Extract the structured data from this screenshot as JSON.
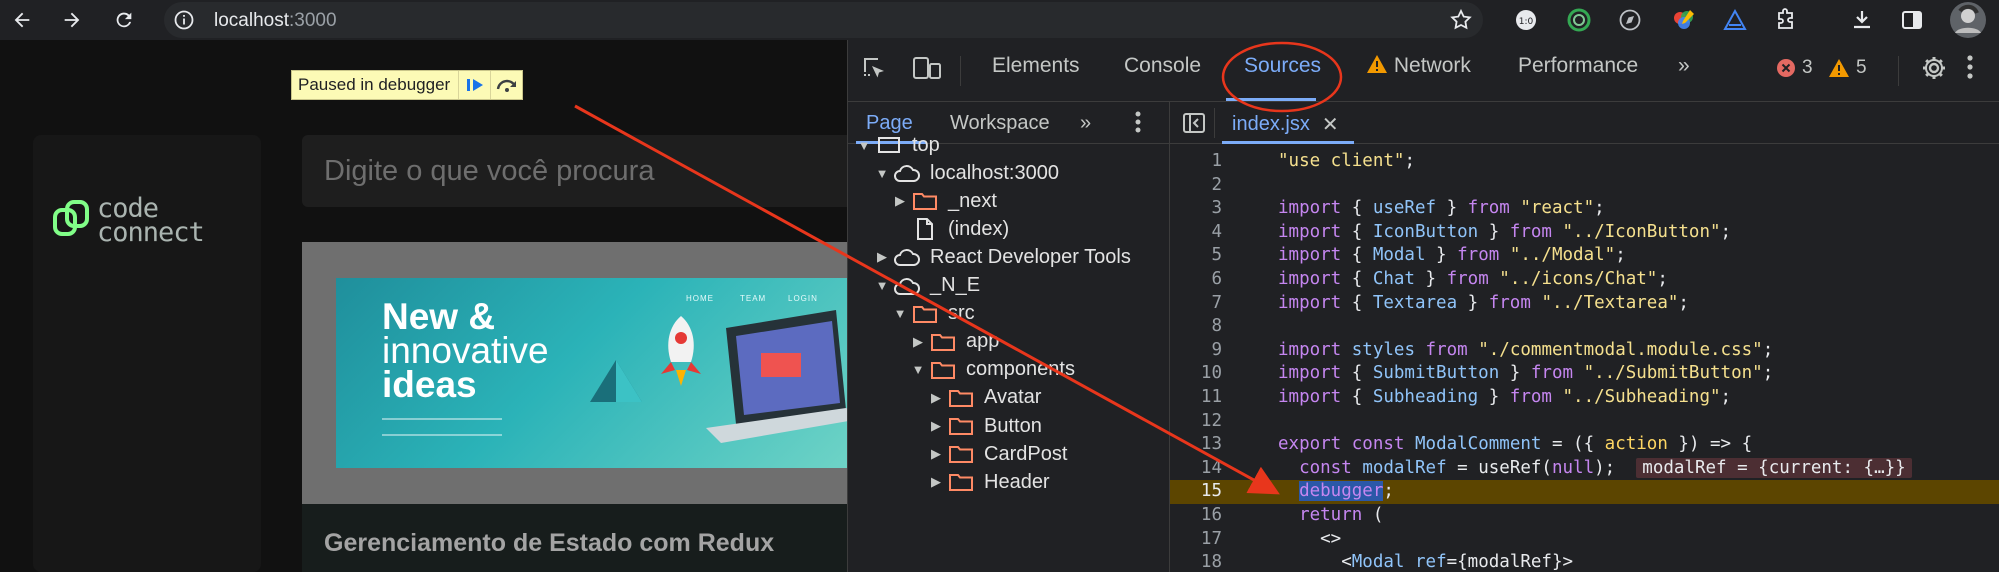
{
  "browser": {
    "url_host": "localhost",
    "url_port": ":3000",
    "extensions": [
      "extension-1-icon",
      "extension-2-icon",
      "extension-3-icon",
      "extension-4-icon",
      "extension-5-icon"
    ]
  },
  "page": {
    "paused_banner": "Paused in debugger",
    "logo_line1": "code",
    "logo_line2": "connect",
    "search_placeholder": "Digite o que você procura",
    "banner": {
      "line1": "New &",
      "line2": "innovative",
      "line3": "ideas",
      "nav": [
        "HOME",
        "TEAM",
        "LOGIN"
      ]
    },
    "card_title": "Gerenciamento de Estado com Redux"
  },
  "devtools": {
    "tabs": [
      "Elements",
      "Console",
      "Sources",
      "Network",
      "Performance"
    ],
    "active_tab": "Sources",
    "error_count": "3",
    "warning_count": "5",
    "nav_tabs": [
      "Page",
      "Workspace"
    ],
    "active_nav_tab": "Page",
    "tree": [
      {
        "label": "top",
        "depth": 0,
        "type": "frame",
        "expanded": true
      },
      {
        "label": "localhost:3000",
        "depth": 1,
        "type": "cloud",
        "expanded": true
      },
      {
        "label": "_next",
        "depth": 2,
        "type": "folder",
        "expanded": false
      },
      {
        "label": "(index)",
        "depth": 2,
        "type": "file",
        "expanded": null
      },
      {
        "label": "React Developer Tools",
        "depth": 1,
        "type": "cloud",
        "expanded": false
      },
      {
        "label": "_N_E",
        "depth": 1,
        "type": "cloud",
        "expanded": true
      },
      {
        "label": "src",
        "depth": 2,
        "type": "folder",
        "expanded": true
      },
      {
        "label": "app",
        "depth": 3,
        "type": "folder",
        "expanded": false
      },
      {
        "label": "components",
        "depth": 3,
        "type": "folder",
        "expanded": true
      },
      {
        "label": "Avatar",
        "depth": 4,
        "type": "folder",
        "expanded": false
      },
      {
        "label": "Button",
        "depth": 4,
        "type": "folder",
        "expanded": false
      },
      {
        "label": "CardPost",
        "depth": 4,
        "type": "folder",
        "expanded": false
      },
      {
        "label": "Header",
        "depth": 4,
        "type": "folder",
        "expanded": false
      }
    ],
    "open_file": "index.jsx",
    "paused_line": 15,
    "code_lines": [
      {
        "n": "1",
        "parts": [
          [
            "str",
            "\"use client\""
          ],
          [
            "",
            ";"
          ]
        ]
      },
      {
        "n": "2",
        "parts": []
      },
      {
        "n": "3",
        "parts": [
          [
            "kw",
            "import"
          ],
          [
            "",
            " { "
          ],
          [
            "var",
            "useRef"
          ],
          [
            "",
            " } "
          ],
          [
            "kw",
            "from"
          ],
          [
            "",
            " "
          ],
          [
            "str",
            "\"react\""
          ],
          [
            "",
            ";"
          ]
        ]
      },
      {
        "n": "4",
        "parts": [
          [
            "kw",
            "import"
          ],
          [
            "",
            " { "
          ],
          [
            "var",
            "IconButton"
          ],
          [
            "",
            " } "
          ],
          [
            "kw",
            "from"
          ],
          [
            "",
            " "
          ],
          [
            "str",
            "\"../IconButton\""
          ],
          [
            "",
            ";"
          ]
        ]
      },
      {
        "n": "5",
        "parts": [
          [
            "kw",
            "import"
          ],
          [
            "",
            " { "
          ],
          [
            "var",
            "Modal"
          ],
          [
            "",
            " } "
          ],
          [
            "kw",
            "from"
          ],
          [
            "",
            " "
          ],
          [
            "str",
            "\"../Modal\""
          ],
          [
            "",
            ";"
          ]
        ]
      },
      {
        "n": "6",
        "parts": [
          [
            "kw",
            "import"
          ],
          [
            "",
            " { "
          ],
          [
            "var",
            "Chat"
          ],
          [
            "",
            " } "
          ],
          [
            "kw",
            "from"
          ],
          [
            "",
            " "
          ],
          [
            "str",
            "\"../icons/Chat\""
          ],
          [
            "",
            ";"
          ]
        ]
      },
      {
        "n": "7",
        "parts": [
          [
            "kw",
            "import"
          ],
          [
            "",
            " { "
          ],
          [
            "var",
            "Textarea"
          ],
          [
            "",
            " } "
          ],
          [
            "kw",
            "from"
          ],
          [
            "",
            " "
          ],
          [
            "str",
            "\"../Textarea\""
          ],
          [
            "",
            ";"
          ]
        ]
      },
      {
        "n": "8",
        "parts": []
      },
      {
        "n": "9",
        "parts": [
          [
            "kw",
            "import"
          ],
          [
            "",
            " "
          ],
          [
            "var",
            "styles"
          ],
          [
            "",
            " "
          ],
          [
            "kw",
            "from"
          ],
          [
            "",
            " "
          ],
          [
            "str",
            "\"./commentmodal.module.css\""
          ],
          [
            "",
            ";"
          ]
        ]
      },
      {
        "n": "10",
        "parts": [
          [
            "kw",
            "import"
          ],
          [
            "",
            " { "
          ],
          [
            "var",
            "SubmitButton"
          ],
          [
            "",
            " } "
          ],
          [
            "kw",
            "from"
          ],
          [
            "",
            " "
          ],
          [
            "str",
            "\"../SubmitButton\""
          ],
          [
            "",
            ";"
          ]
        ]
      },
      {
        "n": "11",
        "parts": [
          [
            "kw",
            "import"
          ],
          [
            "",
            " { "
          ],
          [
            "var",
            "Subheading"
          ],
          [
            "",
            " } "
          ],
          [
            "kw",
            "from"
          ],
          [
            "",
            " "
          ],
          [
            "str",
            "\"../Subheading\""
          ],
          [
            "",
            ";"
          ]
        ]
      },
      {
        "n": "12",
        "parts": []
      },
      {
        "n": "13",
        "parts": [
          [
            "kw",
            "export"
          ],
          [
            "",
            " "
          ],
          [
            "kw",
            "const"
          ],
          [
            "",
            " "
          ],
          [
            "fn",
            "ModalComment"
          ],
          [
            "",
            " = ({ "
          ],
          [
            "param",
            "action"
          ],
          [
            "",
            " }) => {"
          ]
        ]
      },
      {
        "n": "14",
        "parts": [
          [
            "",
            "  "
          ],
          [
            "kw",
            "const"
          ],
          [
            "",
            " "
          ],
          [
            "var",
            "modalRef"
          ],
          [
            "",
            " = useRef("
          ],
          [
            "kw",
            "null"
          ],
          [
            "",
            ");  "
          ],
          [
            "inline",
            "modalRef = {current: {…}}"
          ]
        ]
      },
      {
        "n": "15",
        "parts": [
          [
            "",
            "  "
          ],
          [
            "dbg",
            "debugger"
          ],
          [
            "",
            ";"
          ]
        ]
      },
      {
        "n": "16",
        "parts": [
          [
            "",
            "  "
          ],
          [
            "kw",
            "return"
          ],
          [
            "",
            " ("
          ]
        ]
      },
      {
        "n": "17",
        "parts": [
          [
            "",
            "    <>"
          ]
        ]
      },
      {
        "n": "18",
        "parts": [
          [
            "",
            "      <"
          ],
          [
            "fn",
            "Modal"
          ],
          [
            "",
            " "
          ],
          [
            "var",
            "ref"
          ],
          [
            "",
            "={modalRef}>"
          ]
        ]
      }
    ]
  },
  "colors": {
    "accent": "#7cacf8",
    "error": "#f28b82",
    "warning": "#fdd663",
    "annotation": "#e8361c"
  }
}
